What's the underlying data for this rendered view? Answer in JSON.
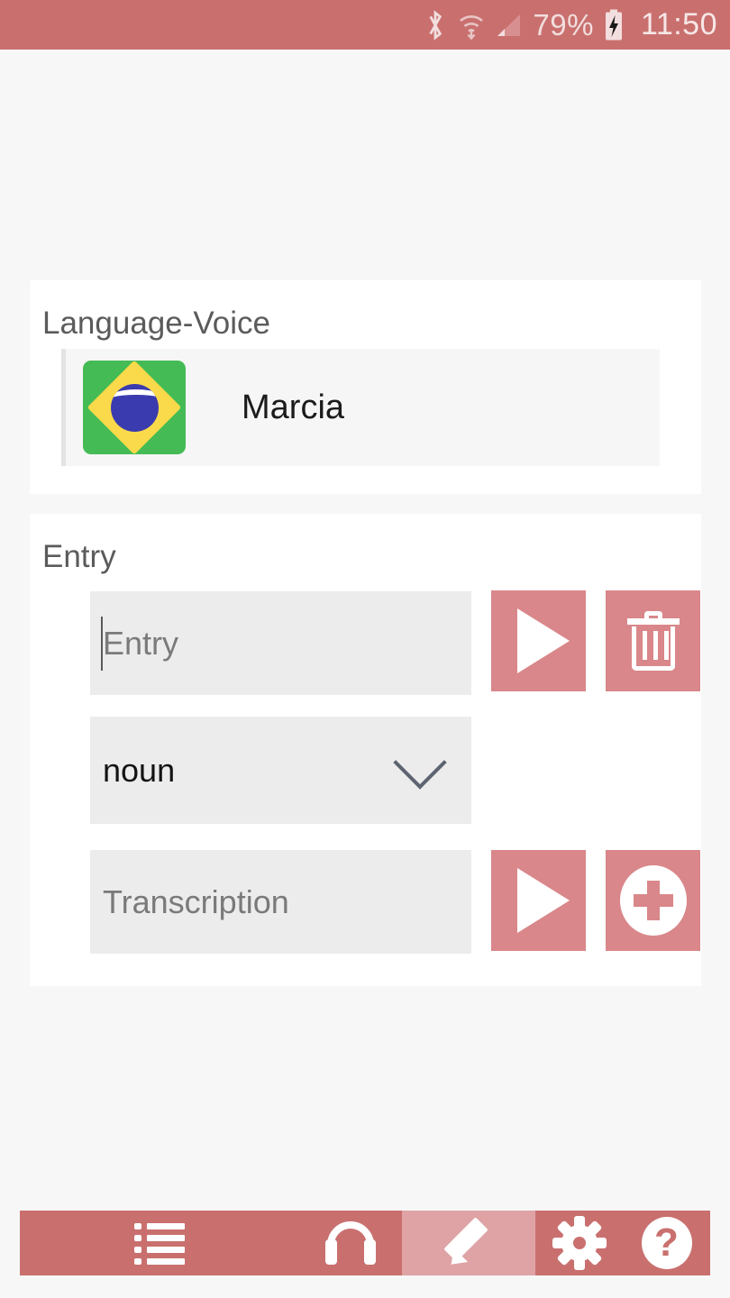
{
  "status_bar": {
    "bluetooth_icon": "bluetooth-icon",
    "wifi_icon": "wifi-down-icon",
    "signal_icon": "cellular-signal-icon",
    "battery_percent": "79%",
    "battery_icon": "battery-charging-icon",
    "clock": "11:50",
    "background_color": "#c9706f"
  },
  "language_voice_card": {
    "title": "Language-Voice",
    "voice": {
      "flag_icon": "brazil-flag-icon",
      "name": "Marcia"
    }
  },
  "entry_card": {
    "title": "Entry",
    "entry_field": {
      "placeholder": "Entry",
      "value": "",
      "has_caret": true
    },
    "entry_play_button": "play-icon",
    "entry_delete_button": "trash-icon",
    "part_of_speech": {
      "selected": "noun",
      "chevron": "chevron-down-icon"
    },
    "transcription_field": {
      "placeholder": "Transcription",
      "value": ""
    },
    "transcription_play_button": "play-icon",
    "transcription_add_button": "add-circle-icon"
  },
  "bottom_nav": {
    "background_color": "#c9706f",
    "active_color": "#dfa3a5",
    "items": [
      {
        "name": "list",
        "icon": "list-icon",
        "active": false
      },
      {
        "name": "listen",
        "icon": "headphones-icon",
        "active": false
      },
      {
        "name": "edit",
        "icon": "pencil-icon",
        "active": true
      },
      {
        "name": "settings",
        "icon": "gear-icon",
        "active": false
      },
      {
        "name": "help",
        "icon": "help-icon",
        "active": false,
        "glyph": "?"
      }
    ]
  },
  "theme": {
    "accent": "#d9878a",
    "page_background": "#f7f7f7",
    "card_background": "#ffffff",
    "field_background": "#ececec"
  }
}
